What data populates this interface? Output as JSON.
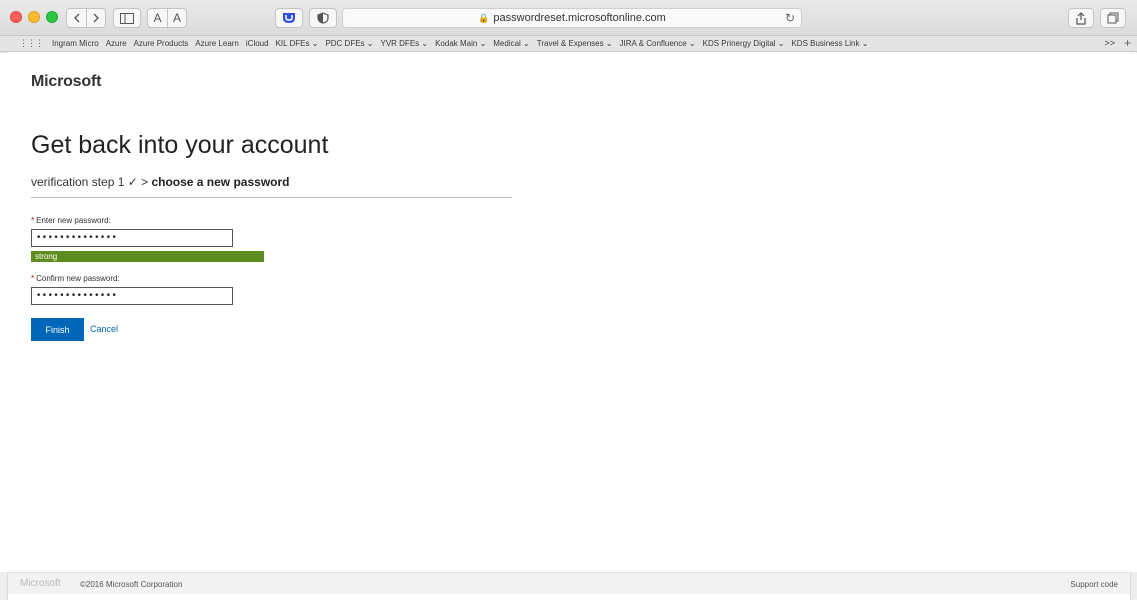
{
  "browser": {
    "url": "passwordreset.microsoftonline.com",
    "reader_labels": [
      "A",
      "A"
    ],
    "bookmarks": [
      "Ingram Micro",
      "Azure",
      "Azure Products",
      "Azure Learn",
      "iCloud",
      "KIL DFEs ⌄",
      "PDC DFEs ⌄",
      "YVR DFEs ⌄",
      "Kodak Main ⌄",
      "Medical ⌄",
      "Travel & Expenses ⌄",
      "JIRA & Confluence ⌄",
      "KDS Prinergy Digital ⌄",
      "KDS Business Link ⌄"
    ],
    "more_label": ">>",
    "add_label": "+"
  },
  "page": {
    "brand": "Microsoft",
    "title": "Get back into your account",
    "steps_prefix": "verification step 1 ✓ > ",
    "steps_current": "choose a new password",
    "new_password_label": "Enter new password:",
    "new_password_value": "••••••••••••••",
    "strength_label": "strong",
    "confirm_password_label": "Confirm new password:",
    "confirm_password_value": "••••••••••••••",
    "required_marker": "*",
    "finish_label": "Finish",
    "cancel_label": "Cancel"
  },
  "footer": {
    "brand": "Microsoft",
    "copyright": "©2016 Microsoft Corporation",
    "support": "Support code"
  },
  "colors": {
    "primary_button": "#0067b8",
    "strength_bar": "#5e8d1f",
    "required": "#cc0000"
  }
}
